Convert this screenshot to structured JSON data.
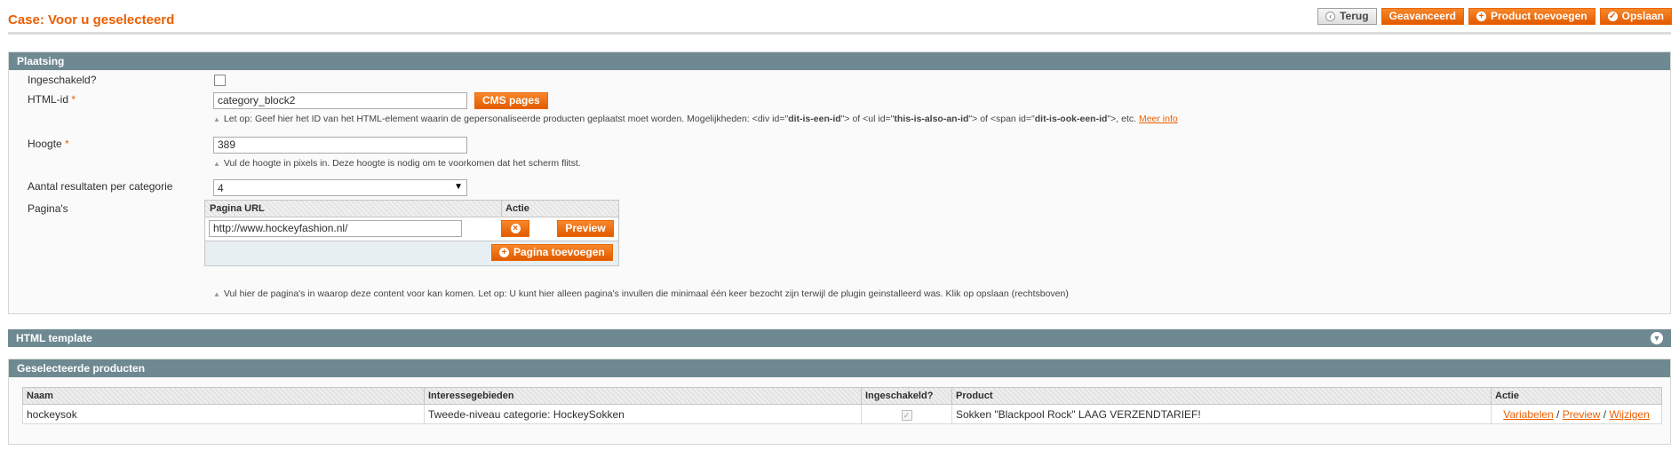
{
  "page": {
    "title": "Case: Voor u geselecteerd"
  },
  "toolbar": {
    "back_label": "Terug",
    "advanced_label": "Geavanceerd",
    "add_product_label": "Product toevoegen",
    "save_label": "Opslaan"
  },
  "placement": {
    "heading": "Plaatsing",
    "enabled_label": "Ingeschakeld?",
    "html_id_label": "HTML-id",
    "html_id_value": "category_block2",
    "cms_pages_label": "CMS pages",
    "html_id_note_1": "Let op: Geef hier het ID van het HTML-element waarin de gepersonaliseerde producten geplaatst moet worden. Mogelijkheden: <div id=\"",
    "html_id_note_id1": "dit-is-een-id",
    "html_id_note_2": "\"> of <ul id=\"",
    "html_id_note_id2": "this-is-also-an-id",
    "html_id_note_3": "\"> of <span id=\"",
    "html_id_note_id3": "dit-is-ook-een-id",
    "html_id_note_4": "\">, etc.",
    "more_info_link": "Meer info",
    "height_label": "Hoogte",
    "height_value": "389",
    "height_note": "Vul de hoogte in pixels in. Deze hoogte is nodig om te voorkomen dat het scherm flitst.",
    "results_label": "Aantal resultaten per categorie",
    "results_value": "4",
    "pages_label": "Pagina's",
    "pages_col_url": "Pagina URL",
    "pages_col_action": "Actie",
    "page_url_value": "http://www.hockeyfashion.nl/",
    "preview_label": "Preview",
    "add_page_label": "Pagina toevoegen",
    "pages_note": "Vul hier de pagina's in waarop deze content voor kan komen. Let op: U kunt hier alleen pagina's invullen die minimaal één keer bezocht zijn terwijl de plugin geinstalleerd was. Klik op opslaan (rechtsboven)"
  },
  "template": {
    "heading": "HTML template"
  },
  "products": {
    "heading": "Geselecteerde producten",
    "columns": [
      "Naam",
      "Interessegebieden",
      "Ingeschakeld?",
      "Product",
      "Actie"
    ],
    "rows": [
      {
        "name": "hockeysok",
        "interests": "Tweede-niveau categorie: HockeySokken",
        "enabled": true,
        "product": "Sokken \"Blackpool Rock\" LAAG VERZENDTARIEF!",
        "action_variables": "Variabelen",
        "action_preview": "Preview",
        "action_edit": "Wijzigen"
      }
    ]
  },
  "colors": {
    "accent": "#eb5e00",
    "section_header": "#6f8992"
  }
}
